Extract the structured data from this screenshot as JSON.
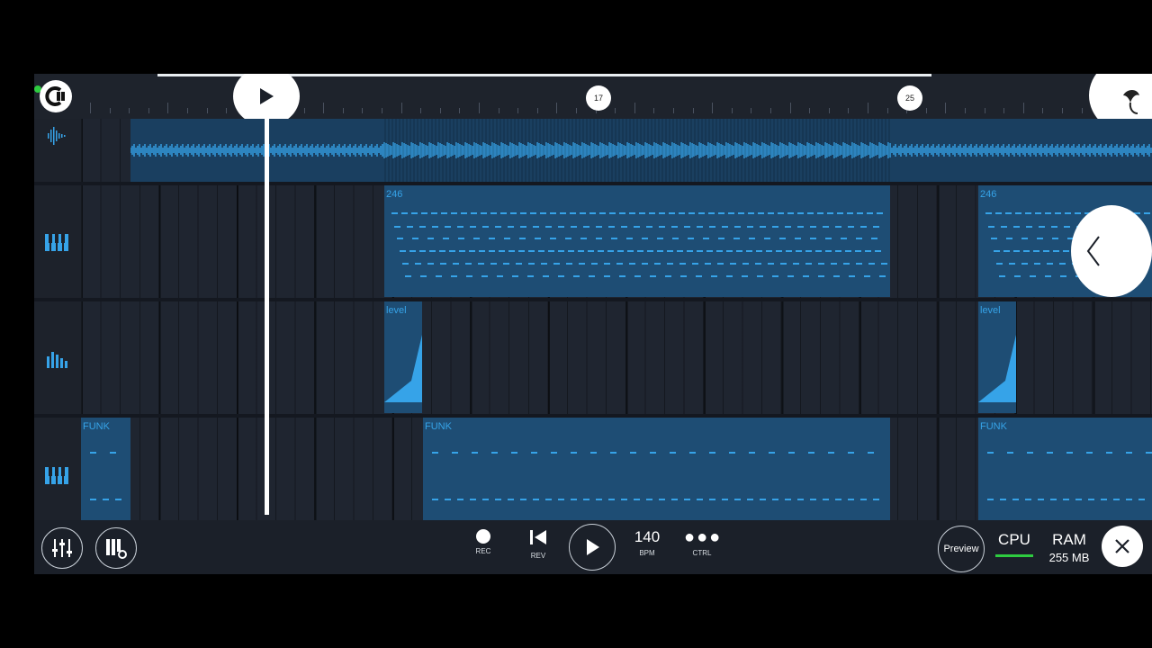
{
  "timeline": {
    "markers": [
      {
        "label": "17"
      },
      {
        "label": "25"
      }
    ]
  },
  "tracks": [
    {
      "icon": "waveform-icon",
      "clips": []
    },
    {
      "icon": "piano-keys-icon",
      "clips": [
        {
          "label": "246"
        },
        {
          "label": "246"
        }
      ]
    },
    {
      "icon": "equalizer-icon",
      "clips": [
        {
          "label": "level"
        },
        {
          "label": "level"
        }
      ]
    },
    {
      "icon": "piano-keys-icon",
      "clips": [
        {
          "label": "FUNK"
        },
        {
          "label": "FUNK"
        },
        {
          "label": "FUNK"
        }
      ]
    }
  ],
  "transport": {
    "rec_label": "REC",
    "rev_label": "REV",
    "bpm_value": "140",
    "bpm_label": "BPM",
    "ctrl_label": "CTRL",
    "preview_label": "Preview",
    "cpu_label": "CPU",
    "ram_label": "RAM",
    "ram_value": "255 MB"
  },
  "colors": {
    "accent": "#36a3e8",
    "background": "#1b2029",
    "clip": "#1e4d74",
    "cpu_meter": "#2ecc40"
  }
}
